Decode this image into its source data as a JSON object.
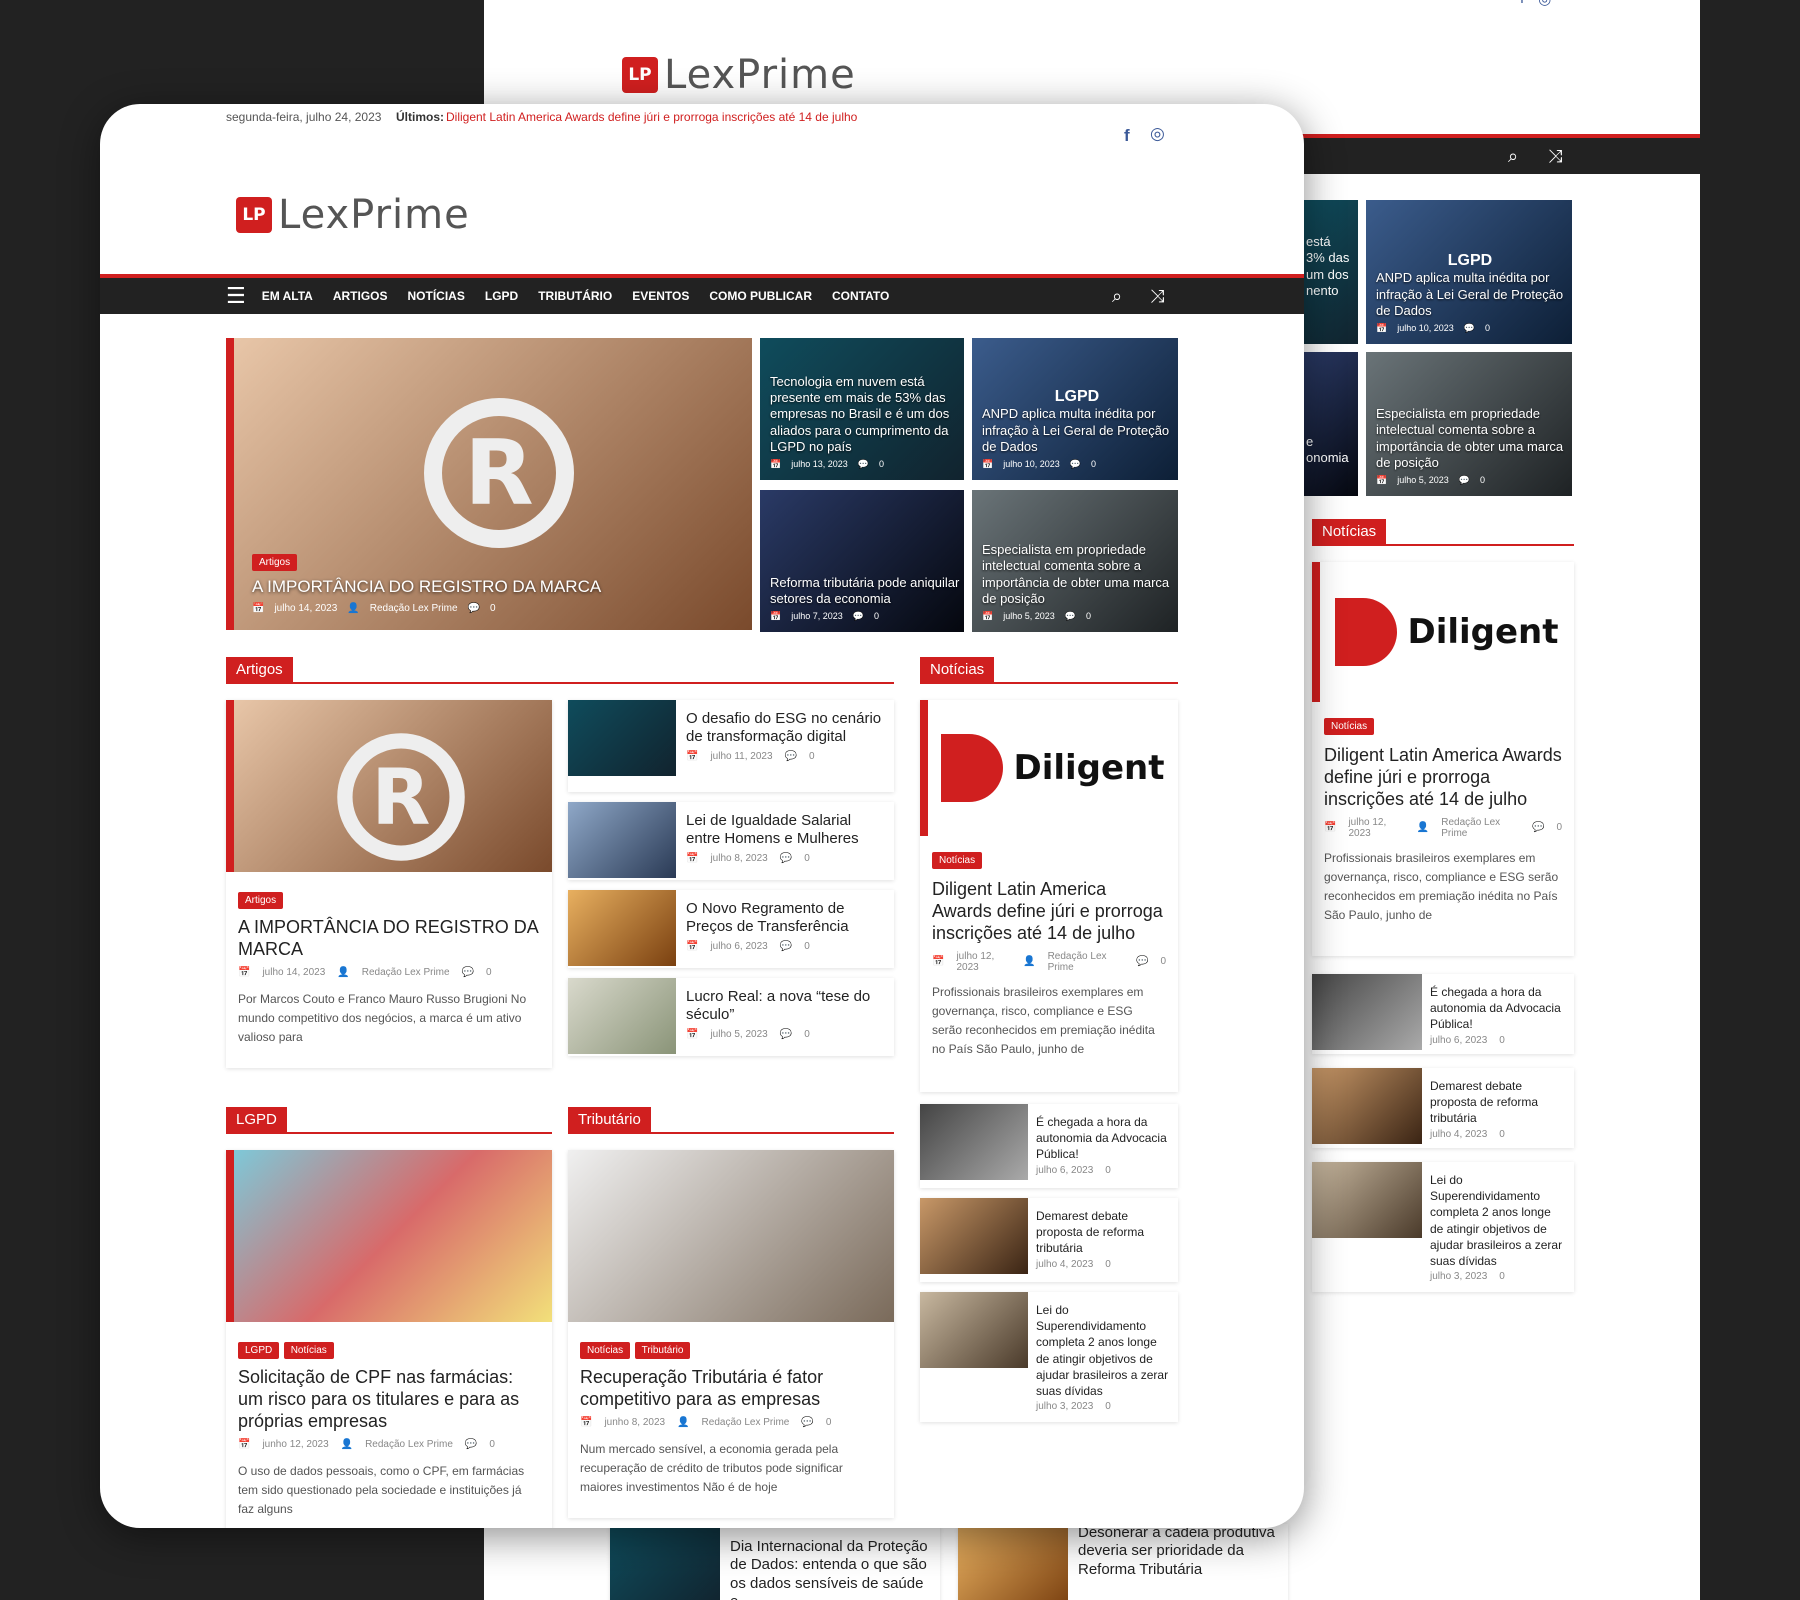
{
  "brand": {
    "logo_mark": "LP",
    "logo_word": "LexPrime"
  },
  "topbar": {
    "date": "segunda-feira, julho 24, 2023",
    "latest_label": "Últimos:",
    "latest_link": "Diligent Latin America Awards define júri e prorroga inscrições até 14 de julho"
  },
  "social": {
    "facebook": "f",
    "instagram": "◎"
  },
  "nav": {
    "menu_icon": "☰",
    "items": [
      "EM ALTA",
      "ARTIGOS",
      "NOTÍCIAS",
      "LGPD",
      "TRIBUTÁRIO",
      "EVENTOS",
      "COMO PUBLICAR",
      "CONTATO"
    ],
    "search_icon": "⌕",
    "shuffle_icon": "⤨"
  },
  "hero": {
    "main": {
      "badge": "Artigos",
      "title": "A IMPORTÂNCIA DO REGISTRO DA MARCA",
      "date": "julho 14, 2023",
      "author": "Redação Lex Prime",
      "comments": "0",
      "image_letter": "R"
    },
    "tiles": [
      {
        "title": "Tecnologia em nuvem está presente em mais de 53% das empresas no Brasil e é um dos aliados para o cumprimento da LGPD no país",
        "date": "julho 13, 2023",
        "comments": "0"
      },
      {
        "label": "LGPD",
        "title": "ANPD aplica multa inédita por infração à Lei Geral de Proteção de Dados",
        "date": "julho 10, 2023",
        "comments": "0"
      },
      {
        "title": "Reforma tributária pode aniquilar setores da economia",
        "date": "julho 7, 2023",
        "comments": "0"
      },
      {
        "title": "Especialista em propriedade intelectual comenta sobre a importância de obter uma marca de posição",
        "date": "julho 5, 2023",
        "comments": "0"
      }
    ]
  },
  "artigos": {
    "section": "Artigos",
    "main": {
      "badge": "Artigos",
      "title": "A IMPORTÂNCIA DO REGISTRO DA MARCA",
      "date": "julho 14, 2023",
      "author": "Redação Lex Prime",
      "comments": "0",
      "excerpt": "Por Marcos Couto e Franco Mauro Russo Brugioni No mundo competitivo dos negócios, a marca é um ativo valioso para",
      "image_letter": "R"
    },
    "list": [
      {
        "title": "O desafio do ESG no cenário de transformação digital",
        "date": "julho 11, 2023",
        "comments": "0"
      },
      {
        "title": "Lei de Igualdade Salarial entre Homens e Mulheres",
        "date": "julho 8, 2023",
        "comments": "0"
      },
      {
        "title": "O Novo Regramento de Preços de Transferência",
        "date": "julho 6, 2023",
        "comments": "0"
      },
      {
        "title": "Lucro Real: a nova “tese do século”",
        "date": "julho 5, 2023",
        "comments": "0"
      }
    ]
  },
  "noticias": {
    "section": "Notícias",
    "main": {
      "logo_text": "Diligent",
      "badge": "Notícias",
      "title": "Diligent Latin America Awards define júri e prorroga inscrições até 14 de julho",
      "date": "julho 12, 2023",
      "author": "Redação Lex Prime",
      "comments": "0",
      "excerpt": "Profissionais brasileiros exemplares em governança, risco, compliance e ESG serão reconhecidos em premiação inédita no País São Paulo, junho de"
    },
    "list": [
      {
        "title": "É chegada a hora da autonomia da Advocacia Pública!",
        "date": "julho 6, 2023",
        "comments": "0"
      },
      {
        "title": "Demarest debate proposta de reforma tributária",
        "date": "julho 4, 2023",
        "comments": "0"
      },
      {
        "title": "Lei do Superendividamento completa 2 anos longe de atingir objetivos de ajudar brasileiros a zerar suas dívidas",
        "date": "julho 3, 2023",
        "comments": "0"
      }
    ]
  },
  "lgpd": {
    "section": "LGPD",
    "main": {
      "badges": [
        "LGPD",
        "Notícias"
      ],
      "title": "Solicitação de CPF nas farmácias: um risco para os titulares e para as próprias empresas",
      "date": "junho 12, 2023",
      "author": "Redação Lex Prime",
      "comments": "0",
      "excerpt": "O uso de dados pessoais, como o CPF, em farmácias tem sido questionado pela sociedade e instituições já faz alguns"
    }
  },
  "tributario": {
    "section": "Tributário",
    "main": {
      "badges": [
        "Notícias",
        "Tributário"
      ],
      "title": "Recuperação Tributária é fator competitivo para as empresas",
      "date": "junho 8, 2023",
      "author": "Redação Lex Prime",
      "comments": "0",
      "excerpt": "Num mercado sensível, a economia gerada pela recuperação de crédito de tributos pode significar maiores investimentos Não é de hoje"
    }
  },
  "back_page": {
    "partial_tiles": [
      {
        "text": "está\n3% das\num dos\nnento"
      },
      {
        "text": "e\nonomia"
      }
    ],
    "bottom": [
      {
        "title": "Dia Internacional da Proteção de Dados: entenda o que são os dados sensíveis de saúde e"
      },
      {
        "title": "Desonerar a cadeia produtiva deveria ser prioridade da Reforma Tributária"
      }
    ]
  }
}
